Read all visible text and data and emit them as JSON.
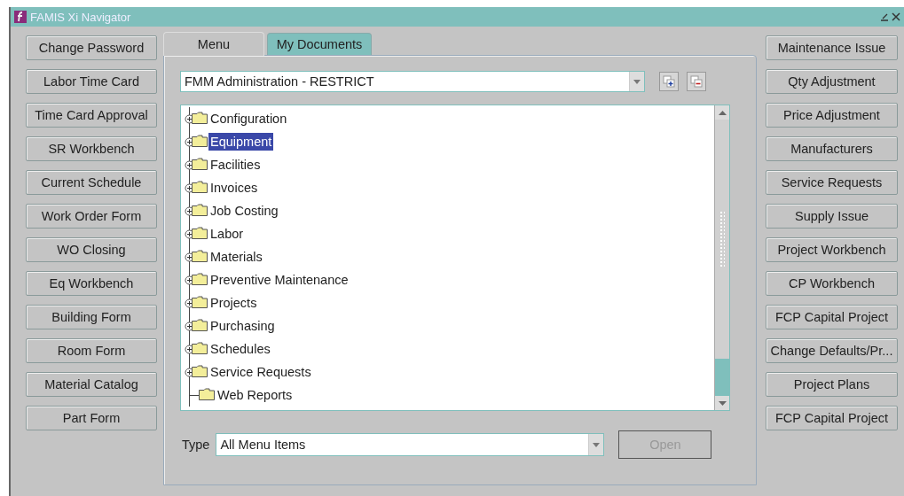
{
  "window": {
    "title": "FAMIS Xi Navigator"
  },
  "left_buttons": [
    "Change Password",
    "Labor Time Card",
    "Time Card Approval",
    "SR Workbench",
    "Current Schedule",
    "Work Order Form",
    "WO Closing",
    "Eq Workbench",
    "Building Form",
    "Room Form",
    "Material Catalog",
    "Part Form"
  ],
  "tabs": [
    {
      "label": "Menu",
      "selected": true
    },
    {
      "label": "My Documents",
      "selected": false
    }
  ],
  "responsibility": {
    "value": "FMM Administration - RESTRICT"
  },
  "tree": [
    {
      "label": "Configuration",
      "expandable": true,
      "selected": false
    },
    {
      "label": "Equipment",
      "expandable": true,
      "selected": true
    },
    {
      "label": "Facilities",
      "expandable": true,
      "selected": false
    },
    {
      "label": "Invoices",
      "expandable": true,
      "selected": false
    },
    {
      "label": "Job Costing",
      "expandable": true,
      "selected": false
    },
    {
      "label": "Labor",
      "expandable": true,
      "selected": false
    },
    {
      "label": "Materials",
      "expandable": true,
      "selected": false
    },
    {
      "label": "Preventive Maintenance",
      "expandable": true,
      "selected": false
    },
    {
      "label": "Projects",
      "expandable": true,
      "selected": false
    },
    {
      "label": "Purchasing",
      "expandable": true,
      "selected": false
    },
    {
      "label": "Schedules",
      "expandable": true,
      "selected": false
    },
    {
      "label": "Service Requests",
      "expandable": true,
      "selected": false
    },
    {
      "label": "Web Reports",
      "expandable": false,
      "selected": false
    }
  ],
  "type": {
    "label": "Type",
    "value": "All Menu Items"
  },
  "open_button": {
    "label": "Open",
    "disabled": true
  },
  "right_buttons": [
    "Maintenance Issue",
    "Qty Adjustment",
    "Price Adjustment",
    "Manufacturers",
    "Service Requests",
    "Supply Issue",
    "Project Workbench",
    "CP Workbench",
    "FCP Capital Project",
    "Change Defaults/Pr...",
    "Project Plans",
    "FCP Capital Project"
  ]
}
